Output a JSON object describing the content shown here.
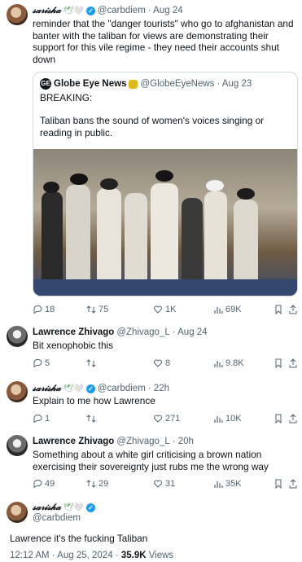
{
  "tweets": [
    {
      "name": "𝓈𝒶𝓇𝒾𝓈𝒽𝒶",
      "emoji": "🕊🤍",
      "handle": "@carbdiem",
      "time": "· Aug 24",
      "text": "reminder that the \"danger tourists\" who go to afghanistan and banter with the taliban for views are demonstrating their support for this vile regime - they need their accounts shut down",
      "actions": {
        "replies": "18",
        "retweets": "75",
        "likes": "1K",
        "views": "69K"
      }
    },
    {
      "name": "Lawrence Zhivago",
      "handle": "@Zhivago_L",
      "time": "· Aug 24",
      "text": "Bit xenophobic this",
      "actions": {
        "replies": "5",
        "retweets": "",
        "likes": "8",
        "views": "9.8K"
      }
    },
    {
      "name": "𝓈𝒶𝓇𝒾𝓈𝒽𝒶",
      "emoji": "🕊🤍",
      "handle": "@carbdiem",
      "time": "· 22h",
      "text": "Explain to me how Lawrence",
      "actions": {
        "replies": "1",
        "retweets": "",
        "likes": "271",
        "views": "10K"
      }
    },
    {
      "name": "Lawrence Zhivago",
      "handle": "@Zhivago_L",
      "time": "· 20h",
      "text": "Something about a white girl criticising a brown nation exercising their sovereignty just rubs me the wrong way",
      "actions": {
        "replies": "49",
        "retweets": "29",
        "likes": "31",
        "views": "35K"
      }
    },
    {
      "name": "𝓈𝒶𝓇𝒾𝓈𝒽𝒶",
      "emoji": "🕊🤍",
      "handle": "@carbdiem",
      "text": "Lawrence it's the fucking Taliban"
    }
  ],
  "quote": {
    "name": "Globe Eye News",
    "logo": "GE",
    "handle": "@GlobeEyeNews",
    "time": "· Aug 23",
    "line1": "BREAKING:",
    "line2": "Taliban bans the sound of women's voices singing or reading in public."
  },
  "footer": {
    "timestamp": "12:12 AM · Aug 25, 2024 ·",
    "views_count": "35.9K",
    "views_label": "Views"
  },
  "colors": {
    "accent": "#1d9bf0",
    "muted": "#536471",
    "border": "#cfd9de"
  },
  "icons": {
    "reply": "reply-icon",
    "retweet": "retweet-icon",
    "like": "heart-icon",
    "views": "views-icon",
    "bookmark": "bookmark-icon",
    "share": "share-icon"
  }
}
